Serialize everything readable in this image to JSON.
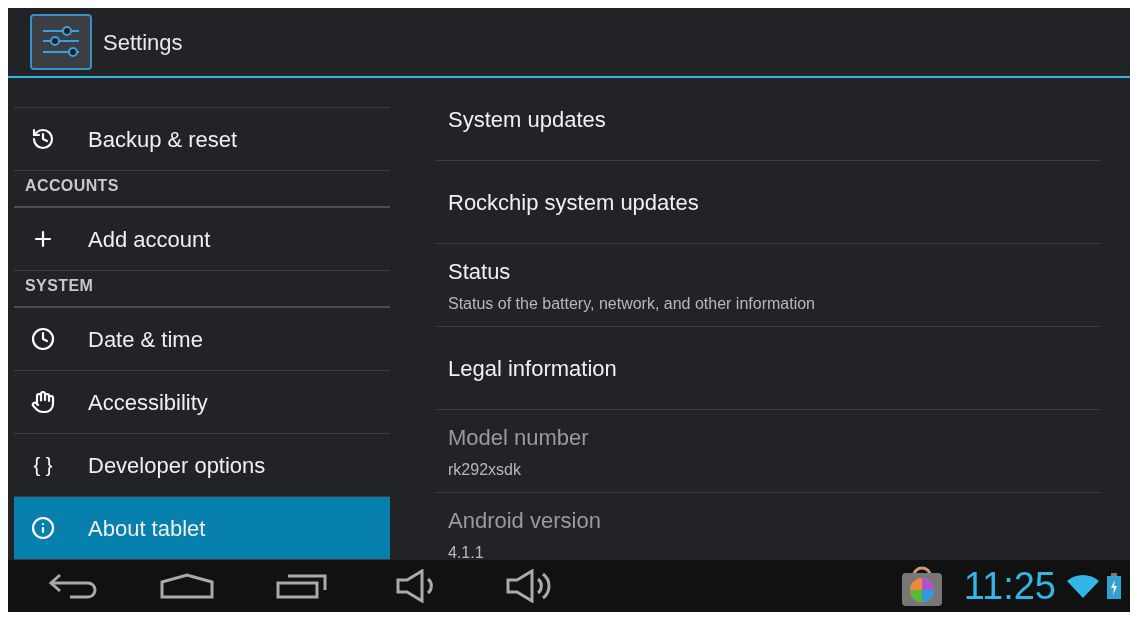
{
  "action_bar": {
    "title": "Settings"
  },
  "sidebar": {
    "items": [
      {
        "kind": "item",
        "label": "Backup & reset",
        "selected": false
      },
      {
        "kind": "header",
        "label": "ACCOUNTS"
      },
      {
        "kind": "item",
        "label": "Add account",
        "selected": false
      },
      {
        "kind": "header",
        "label": "SYSTEM"
      },
      {
        "kind": "item",
        "label": "Date & time",
        "selected": false
      },
      {
        "kind": "item",
        "label": "Accessibility",
        "selected": false
      },
      {
        "kind": "item",
        "icon_text": "{ }",
        "label": "Developer options",
        "selected": false
      },
      {
        "kind": "item",
        "label": "About tablet",
        "selected": true
      }
    ]
  },
  "details": {
    "rows": [
      {
        "title": "System updates",
        "disabled": false
      },
      {
        "title": "Rockchip system updates",
        "disabled": false
      },
      {
        "title": "Status",
        "summary": "Status of the battery, network, and other information",
        "disabled": false
      },
      {
        "title": "Legal information",
        "disabled": false
      },
      {
        "title": "Model number",
        "summary": "rk292xsdk",
        "disabled": true
      },
      {
        "title": "Android version",
        "summary": "4.1.1",
        "disabled": true
      }
    ]
  },
  "status_bar": {
    "time": "11:25"
  }
}
